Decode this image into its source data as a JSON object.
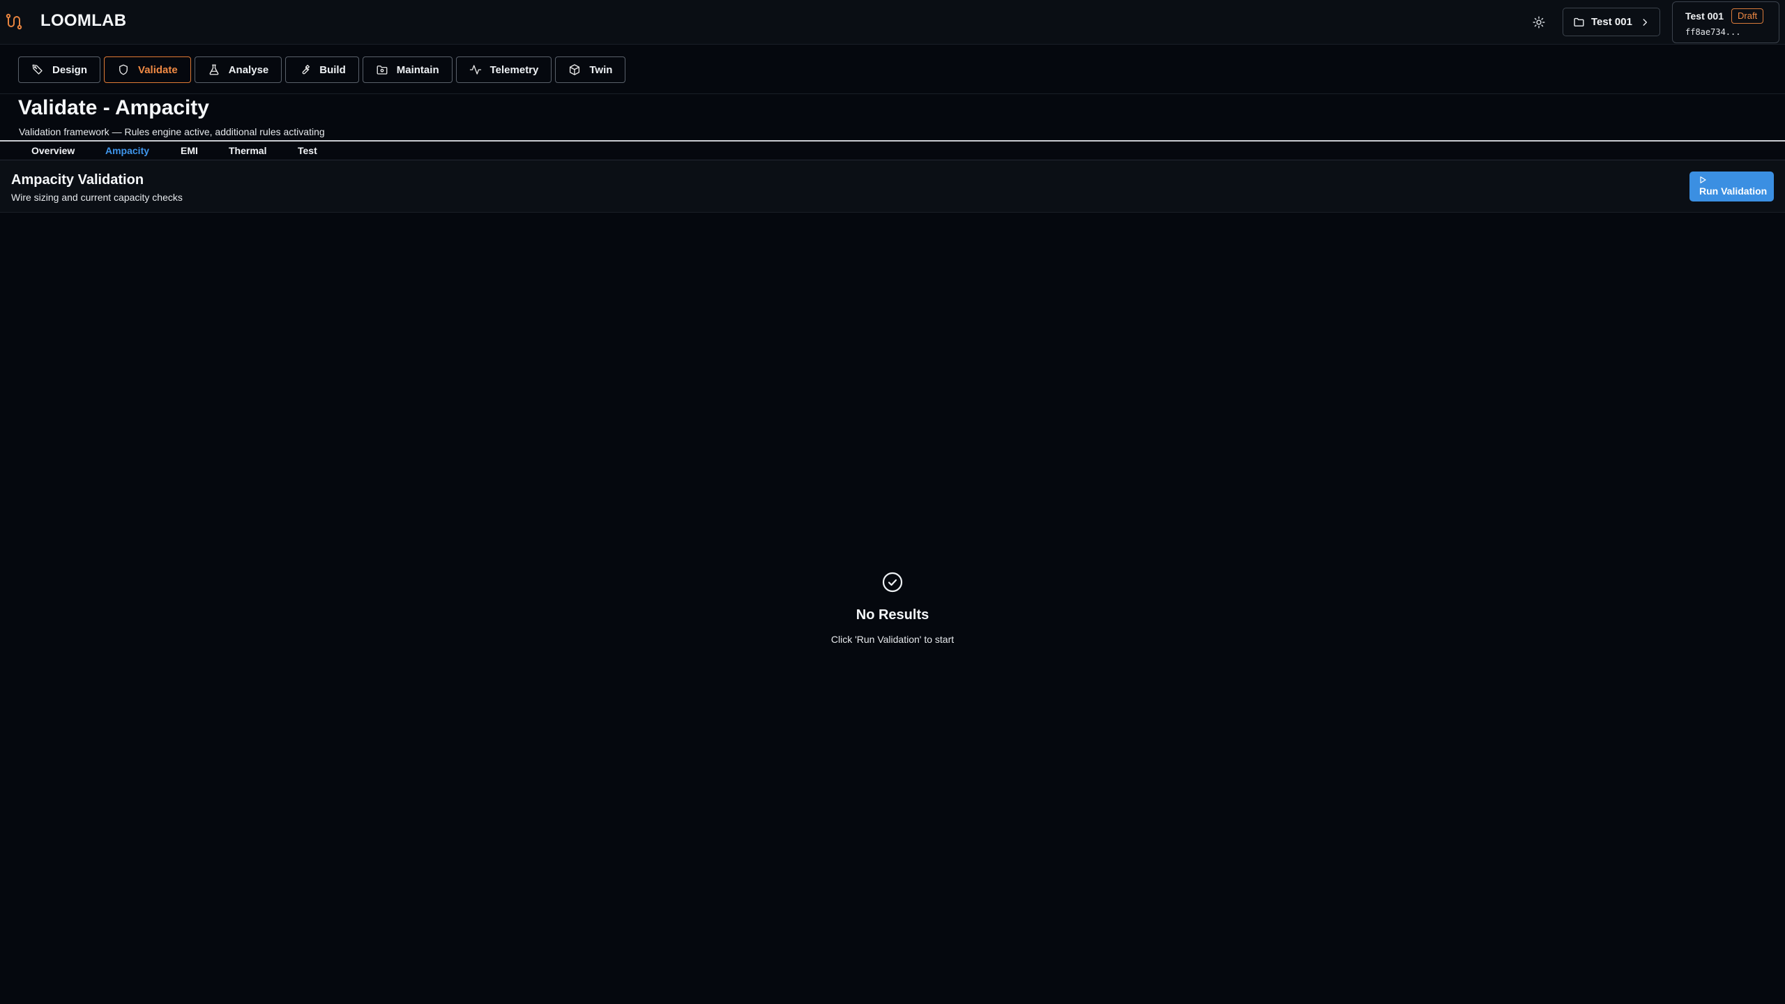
{
  "header": {
    "brand": "LOOMLAB",
    "project_button_label": "Test 001",
    "status_card": {
      "name": "Test 001",
      "badge": "Draft",
      "hash": "ff8ae734..."
    }
  },
  "modules": [
    {
      "label": "Design",
      "icon": "pencil-ruler-icon",
      "active": false
    },
    {
      "label": "Validate",
      "icon": "shield-icon",
      "active": true
    },
    {
      "label": "Analyse",
      "icon": "flask-icon",
      "active": false
    },
    {
      "label": "Build",
      "icon": "wrench-icon",
      "active": false
    },
    {
      "label": "Maintain",
      "icon": "folder-cog-icon",
      "active": false
    },
    {
      "label": "Telemetry",
      "icon": "activity-icon",
      "active": false
    },
    {
      "label": "Twin",
      "icon": "box-icon",
      "active": false
    }
  ],
  "page": {
    "title": "Validate - Ampacity",
    "subtitle": "Validation framework — Rules engine active, additional rules activating"
  },
  "subtabs": [
    {
      "label": "Overview",
      "active": false
    },
    {
      "label": "Ampacity",
      "active": true
    },
    {
      "label": "EMI",
      "active": false
    },
    {
      "label": "Thermal",
      "active": false
    },
    {
      "label": "Test",
      "active": false
    }
  ],
  "section": {
    "title": "Ampacity Validation",
    "subtitle": "Wire sizing and current capacity checks",
    "run_button_label": "Run Validation"
  },
  "empty_state": {
    "title": "No Results",
    "message": "Click 'Run Validation' to start"
  },
  "colors": {
    "background": "#05080e",
    "accent_orange": "#f08a44",
    "accent_blue": "#3b8fe2"
  }
}
